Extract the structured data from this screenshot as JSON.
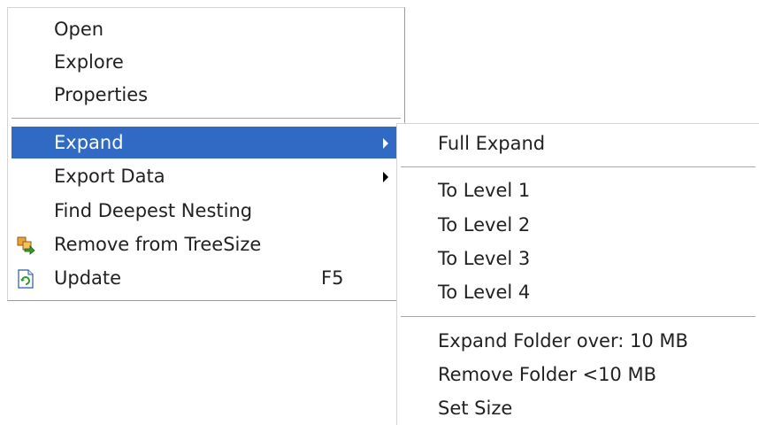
{
  "main_menu": {
    "items": [
      {
        "label": "Open"
      },
      {
        "label": "Explore"
      },
      {
        "label": "Properties"
      },
      {
        "label": "Expand"
      },
      {
        "label": "Export Data"
      },
      {
        "label": "Find Deepest Nesting"
      },
      {
        "label": "Remove from TreeSize",
        "icon": "remove-from-treesize-icon"
      },
      {
        "label": "Update",
        "icon": "update-icon",
        "shortcut": "F5"
      }
    ],
    "selected_item": "Expand",
    "highlight_color": "#316ac5"
  },
  "expand_submenu": {
    "items": [
      {
        "label": "Full Expand"
      },
      {
        "label": "To Level 1"
      },
      {
        "label": "To Level 2"
      },
      {
        "label": "To Level 3"
      },
      {
        "label": "To Level 4"
      },
      {
        "label": "Expand Folder over: 10 MB"
      },
      {
        "label": "Remove Folder <10 MB"
      },
      {
        "label": "Set Size"
      }
    ]
  }
}
